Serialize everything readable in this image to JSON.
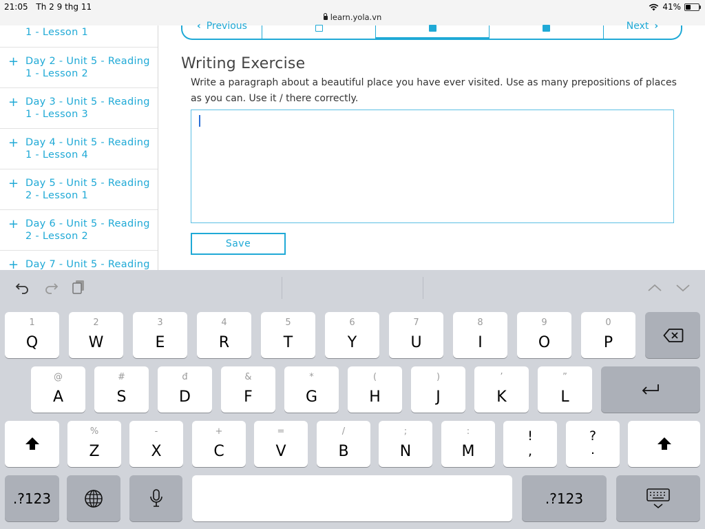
{
  "status": {
    "time": "21:05",
    "date": "Th 2 9 thg 11",
    "url": "learn.yola.vn",
    "battery": "41%",
    "battery_fraction": 0.41
  },
  "sidebar": {
    "items": [
      {
        "label": "1 - Lesson 1"
      },
      {
        "label": "Day 2 - Unit 5 - Reading 1 - Lesson 2"
      },
      {
        "label": "Day 3 - Unit 5 - Reading 1 - Lesson 3"
      },
      {
        "label": "Day 4 - Unit 5 - Reading 1 - Lesson 4"
      },
      {
        "label": "Day 5 - Unit 5 - Reading 2 - Lesson 1"
      },
      {
        "label": "Day 6 - Unit 5 - Reading 2 - Lesson 2"
      },
      {
        "label": "Day 7 - Unit 5 - Reading"
      }
    ]
  },
  "nav": {
    "previous": "Previous",
    "next": "Next"
  },
  "exercise": {
    "title": "Writing Exercise",
    "instruction": "Write a paragraph about a beautiful place you have ever visited. Use as many prepositions of places as you can. Use it / there correctly.",
    "answer": "",
    "save_label": "Save"
  },
  "keyboard": {
    "row1": [
      {
        "alt": "1",
        "main": "Q"
      },
      {
        "alt": "2",
        "main": "W"
      },
      {
        "alt": "3",
        "main": "E"
      },
      {
        "alt": "4",
        "main": "R"
      },
      {
        "alt": "5",
        "main": "T"
      },
      {
        "alt": "6",
        "main": "Y"
      },
      {
        "alt": "7",
        "main": "U"
      },
      {
        "alt": "8",
        "main": "I"
      },
      {
        "alt": "9",
        "main": "O"
      },
      {
        "alt": "0",
        "main": "P"
      }
    ],
    "row2": [
      {
        "alt": "@",
        "main": "A"
      },
      {
        "alt": "#",
        "main": "S"
      },
      {
        "alt": "đ",
        "main": "D"
      },
      {
        "alt": "&",
        "main": "F"
      },
      {
        "alt": "*",
        "main": "G"
      },
      {
        "alt": "(",
        "main": "H"
      },
      {
        "alt": ")",
        "main": "J"
      },
      {
        "alt": "’",
        "main": "K"
      },
      {
        "alt": "”",
        "main": "L"
      }
    ],
    "row3": [
      {
        "alt": "%",
        "main": "Z"
      },
      {
        "alt": "-",
        "main": "X"
      },
      {
        "alt": "+",
        "main": "C"
      },
      {
        "alt": "=",
        "main": "V"
      },
      {
        "alt": "/",
        "main": "B"
      },
      {
        "alt": ";",
        "main": "N"
      },
      {
        "alt": ":",
        "main": "M"
      }
    ],
    "punct1": {
      "top": "!",
      "bottom": ","
    },
    "punct2": {
      "top": "?",
      "bottom": "."
    },
    "numbers_label": ".?123"
  },
  "icons": {
    "undo": "undo-icon",
    "redo": "redo-icon",
    "paste": "paste-icon",
    "globe": "globe-icon",
    "mic": "microphone-icon",
    "backspace": "backspace-icon",
    "return": "return-icon",
    "shift": "shift-icon",
    "hide_keyboard": "hide-keyboard-icon"
  },
  "colors": {
    "accent": "#1fa9d6",
    "keyboard_bg": "#d1d4da"
  }
}
